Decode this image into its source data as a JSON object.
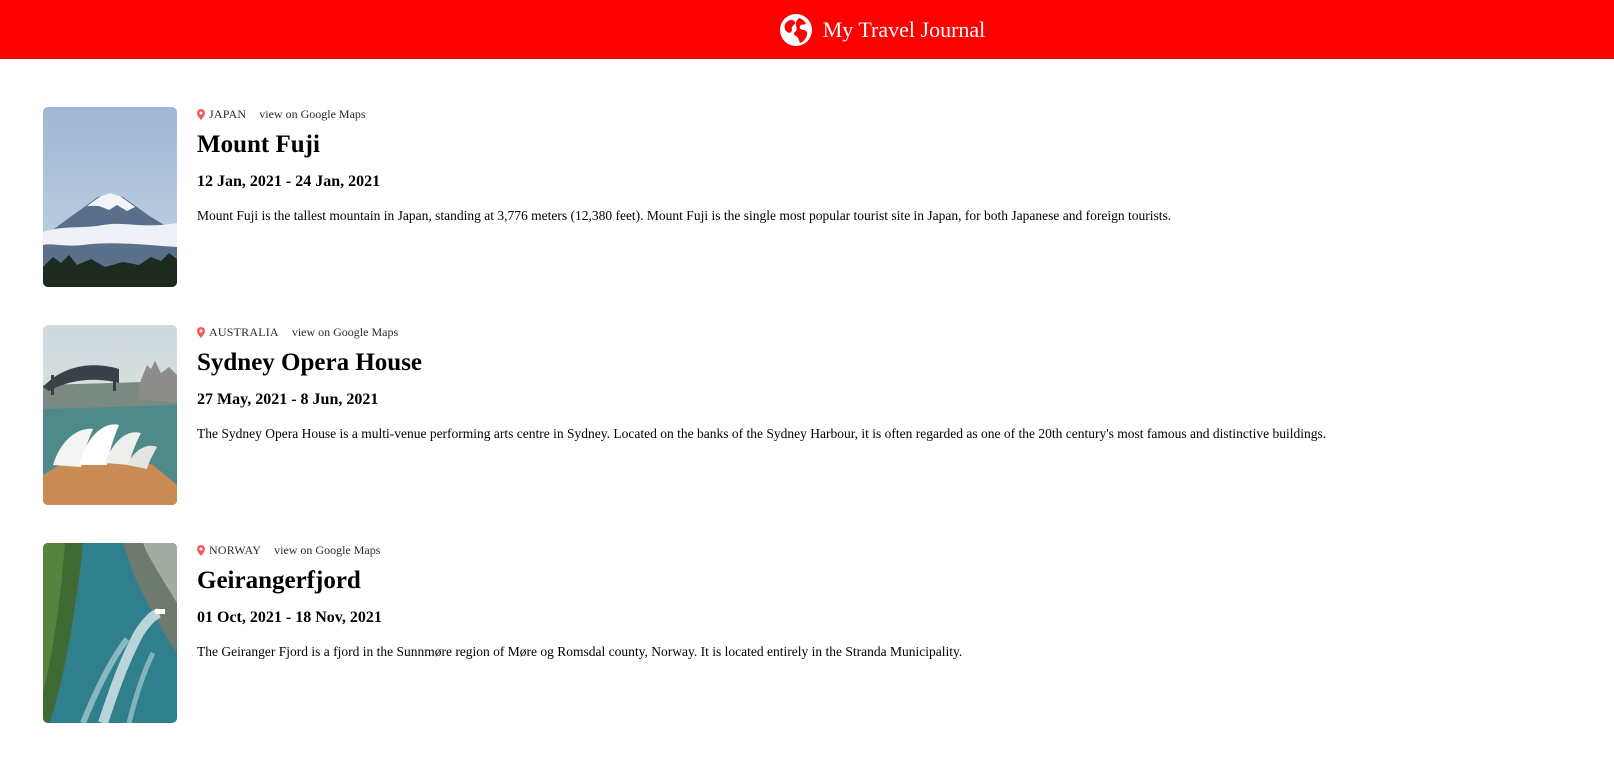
{
  "header": {
    "title": "My Travel Journal",
    "icon": "globe-icon",
    "background_color": "#ff0000"
  },
  "entries": [
    {
      "country": "JAPAN",
      "maps_link": "view on Google Maps",
      "title": "Mount Fuji",
      "dates": "12 Jan, 2021 - 24 Jan, 2021",
      "description": "Mount Fuji is the tallest mountain in Japan, standing at 3,776 meters (12,380 feet). Mount Fuji is the single most popular tourist site in Japan, for both Japanese and foreign tourists.",
      "image": "mount-fuji-photo"
    },
    {
      "country": "AUSTRALIA",
      "maps_link": "view on Google Maps",
      "title": "Sydney Opera House",
      "dates": "27 May, 2021 - 8 Jun, 2021",
      "description": "The Sydney Opera House is a multi-venue performing arts centre in Sydney. Located on the banks of the Sydney Harbour, it is often regarded as one of the 20th century's most famous and distinctive buildings.",
      "image": "sydney-opera-house-photo"
    },
    {
      "country": "NORWAY",
      "maps_link": "view on Google Maps",
      "title": "Geirangerfjord",
      "dates": "01 Oct, 2021 - 18 Nov, 2021",
      "description": "The Geiranger Fjord is a fjord in the Sunnmøre region of Møre og Romsdal county, Norway. It is located entirely in the Stranda Municipality.",
      "image": "geirangerfjord-photo"
    }
  ],
  "colors": {
    "accent": "#ff0000",
    "pin": "#f55a5a"
  }
}
